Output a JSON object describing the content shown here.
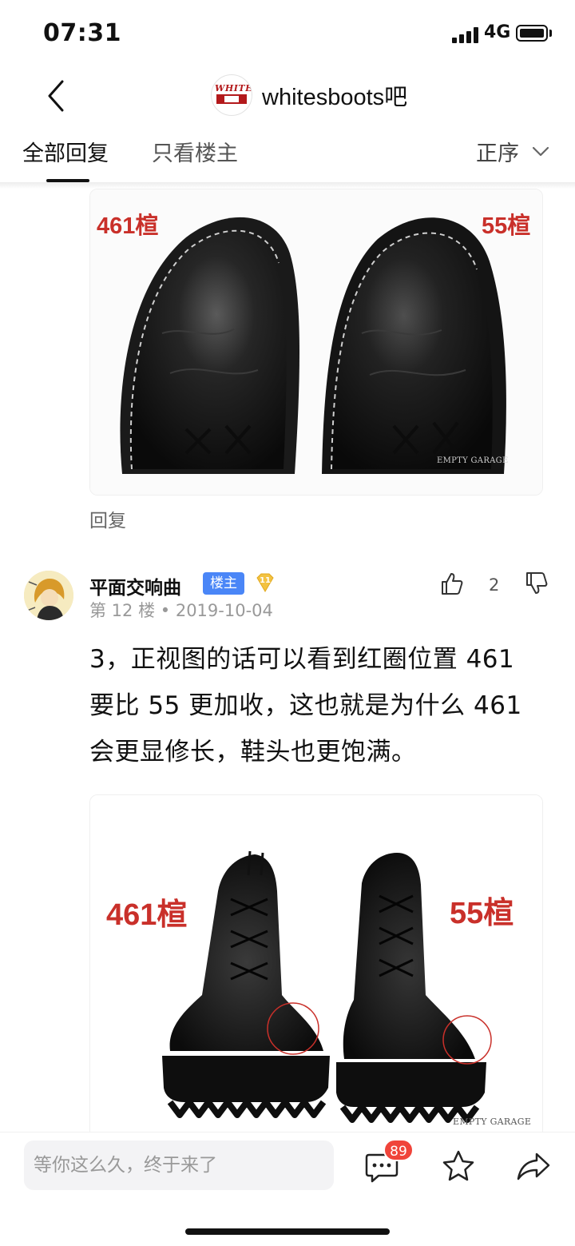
{
  "status_bar": {
    "time": "07:31",
    "network": "4G"
  },
  "nav": {
    "forum_name": "whitesboots吧",
    "logo_text": "WHITES"
  },
  "tabs": {
    "all": "全部回复",
    "op_only": "只看楼主",
    "sort": "正序"
  },
  "image_1": {
    "label_left": "461楦",
    "label_right": "55楦",
    "watermark": "EMPTY GARAGE"
  },
  "reply_link": "回复",
  "comment": {
    "user_name": "平面交响曲",
    "op_badge": "楼主",
    "level": "11",
    "floor": "第 12 楼",
    "date": "2019-10-04",
    "likes": "2",
    "lines": [
      "3，正视图的话可以看到红圈位置 461",
      "要比 55 更加收，这也就是为什么 461",
      "会更显修长，鞋头也更饱满。"
    ]
  },
  "image_2": {
    "label_left": "461楦",
    "label_right": "55楦",
    "watermark": "EMPTY GARAGE"
  },
  "bottom_bar": {
    "input_placeholder": "等你这么久，终于来了",
    "comment_count": "89"
  },
  "colors": {
    "accent_blue": "#4a86f7",
    "label_red": "#c9302a",
    "badge_red": "#f0443a"
  }
}
